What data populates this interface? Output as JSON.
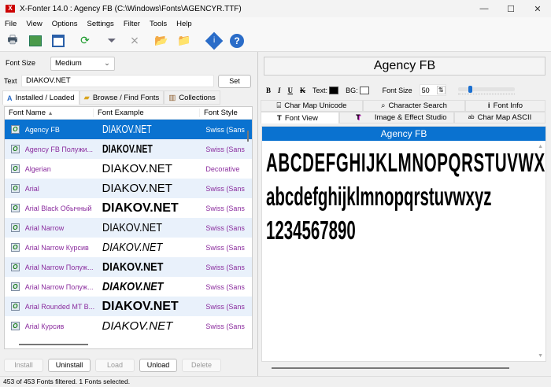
{
  "window": {
    "title": "X-Fonter 14.0  :  Agency FB (C:\\Windows\\Fonts\\AGENCYR.TTF)",
    "minimize": "—",
    "maximize": "☐",
    "close": "✕"
  },
  "menu": [
    "File",
    "View",
    "Options",
    "Settings",
    "Filter",
    "Tools",
    "Help"
  ],
  "toolbar": [
    "print-icon",
    "table-icon",
    "window-icon",
    "refresh-icon",
    "filter-icon",
    "clear-filter-icon",
    "font-folder-icon",
    "export-icon",
    "info-icon",
    "help-icon"
  ],
  "left": {
    "font_size_label": "Font Size",
    "font_size_value": "Medium",
    "text_label": "Text",
    "text_value": "DIAKOV.NET",
    "set_button": "Set",
    "tabs": [
      "Installed / Loaded",
      "Browse / Find Fonts",
      "Collections"
    ],
    "columns": [
      "Font Name",
      "Font Example",
      "Font Style"
    ],
    "rows": [
      {
        "name": "Agency FB",
        "example": "DIAKOV.NET",
        "style": "Swiss (Sans"
      },
      {
        "name": "Agency FB Полужи...",
        "example": "DIAKOV.NET",
        "style": "Swiss (Sans"
      },
      {
        "name": "Algerian",
        "example": "DIAKOV.NET",
        "style": "Decorative"
      },
      {
        "name": "Arial",
        "example": "DIAKOV.NET",
        "style": "Swiss (Sans"
      },
      {
        "name": "Arial Black Обычный",
        "example": "DIAKOV.NET",
        "style": "Swiss (Sans"
      },
      {
        "name": "Arial Narrow",
        "example": "DIAKOV.NET",
        "style": "Swiss (Sans"
      },
      {
        "name": "Arial Narrow Курсив",
        "example": "DIAKOV.NET",
        "style": "Swiss (Sans"
      },
      {
        "name": "Arial Narrow Полуж...",
        "example": "DIAKOV.NET",
        "style": "Swiss (Sans"
      },
      {
        "name": "Arial Narrow Полуж...",
        "example": "DIAKOV.NET",
        "style": "Swiss (Sans"
      },
      {
        "name": "Arial Rounded MT B...",
        "example": "DIAKOV.NET",
        "style": "Swiss (Sans"
      },
      {
        "name": "Arial Курсив",
        "example": "DIAKOV.NET",
        "style": "Swiss (Sans"
      }
    ],
    "buttons": [
      "Install",
      "Uninstall",
      "Load",
      "Unload",
      "Delete"
    ]
  },
  "right": {
    "font_title": "Agency FB",
    "fmt": {
      "bold": "B",
      "italic": "I",
      "underline": "U",
      "strike": "K",
      "text_label": "Text:",
      "bg_label": "BG:",
      "size_label": "Font Size",
      "size_value": "50",
      "text_color": "#000000",
      "bg_color": "#ffffff",
      "slider_percent": 20
    },
    "tabs_row1": [
      "Char Map Unicode",
      "Character Search",
      "Font Info"
    ],
    "tabs_row2": [
      "Font View",
      "Image & Effect Studio",
      "Char Map ASCII"
    ],
    "preview_header": "Agency FB",
    "preview_lines": [
      "ABCDEFGHIJKLMNOPQRSTUVWX",
      "abcdefghijklmnopqrstuvwxyz",
      "1234567890"
    ]
  },
  "status": "453 of 453 Fonts filtered.   1 Fonts selected."
}
